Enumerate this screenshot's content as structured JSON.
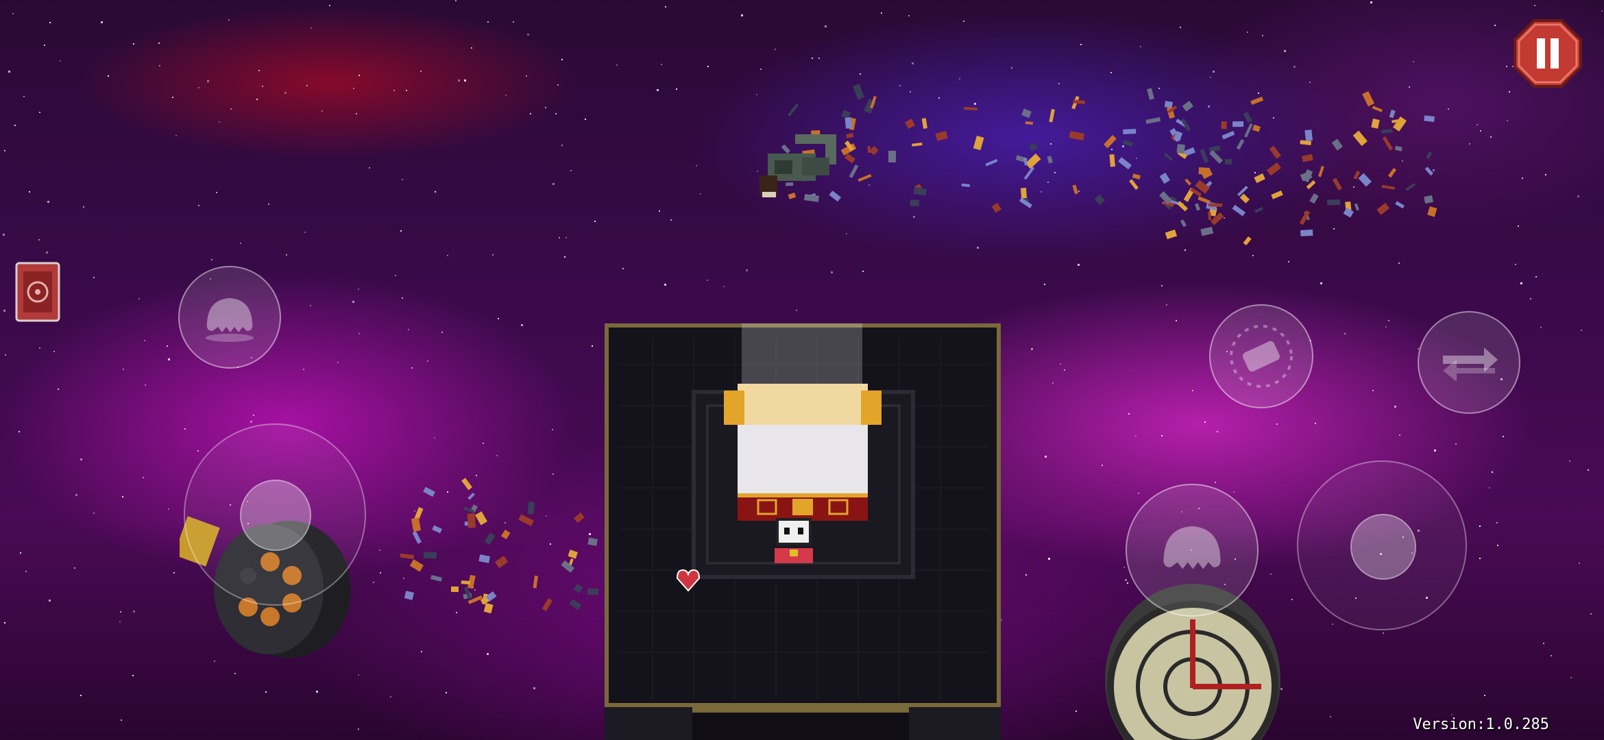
{
  "game": {
    "version_label": "Version:1.0.285"
  },
  "hud": {
    "pause_icon": "pause-icon",
    "active_item_icon": "book-item-icon",
    "left_skill_icon": "ghost-blank-icon",
    "reload_icon": "reload-gun-icon",
    "swap_weapon_icon": "swap-weapon-icon",
    "right_skill_icon": "ghost-blank-icon"
  },
  "colors": {
    "pause_red": "#c23a32",
    "room_border": "#7a6a3a",
    "room_floor": "#141218",
    "chest_red": "#8a1414",
    "chest_gold": "#e2a52a"
  }
}
